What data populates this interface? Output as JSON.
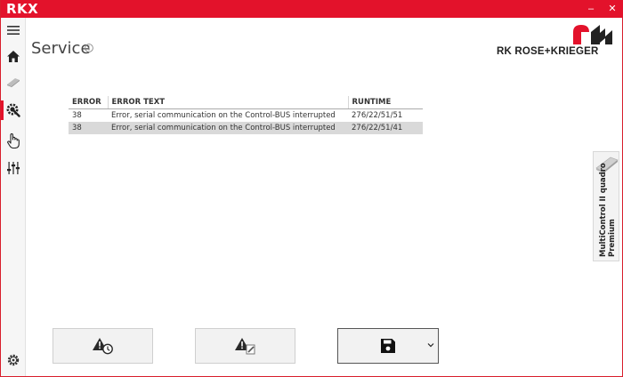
{
  "app": {
    "title": "RKX"
  },
  "window_controls": {
    "minimize": "–",
    "close": "✕"
  },
  "page": {
    "title": "Service"
  },
  "brand": {
    "name": "RK ROSE+KRIEGER",
    "accent": "#e3122b"
  },
  "errors_table": {
    "columns": [
      "ERROR",
      "ERROR TEXT",
      "RUNTIME"
    ],
    "rows": [
      {
        "error": "38",
        "text": "Error, serial communication on the Control-BUS interrupted",
        "runtime": "276/22/51/51",
        "selected": false
      },
      {
        "error": "38",
        "text": "Error, serial communication on the Control-BUS interrupted",
        "runtime": "276/22/51/41",
        "selected": true
      }
    ]
  },
  "device_tab": {
    "line1": "MultiControl II quadro",
    "line2": "Premium",
    "icon": "controller-icon"
  },
  "sidebar": {
    "items": [
      {
        "name": "menu",
        "icon": "hamburger-icon"
      },
      {
        "name": "home",
        "icon": "home-icon"
      },
      {
        "name": "device",
        "icon": "device-icon"
      },
      {
        "name": "service",
        "icon": "service-gear-icon",
        "active": true
      },
      {
        "name": "manual",
        "icon": "hand-icon"
      },
      {
        "name": "settings",
        "icon": "sliders-icon"
      },
      {
        "name": "system",
        "icon": "gear-icon"
      }
    ]
  },
  "buttons": [
    {
      "name": "error-history",
      "icon": "warning-history-icon"
    },
    {
      "name": "error-edit",
      "icon": "warning-edit-icon",
      "disabled": true
    },
    {
      "name": "save",
      "icon": "save-icon",
      "has_dropdown": true
    }
  ]
}
